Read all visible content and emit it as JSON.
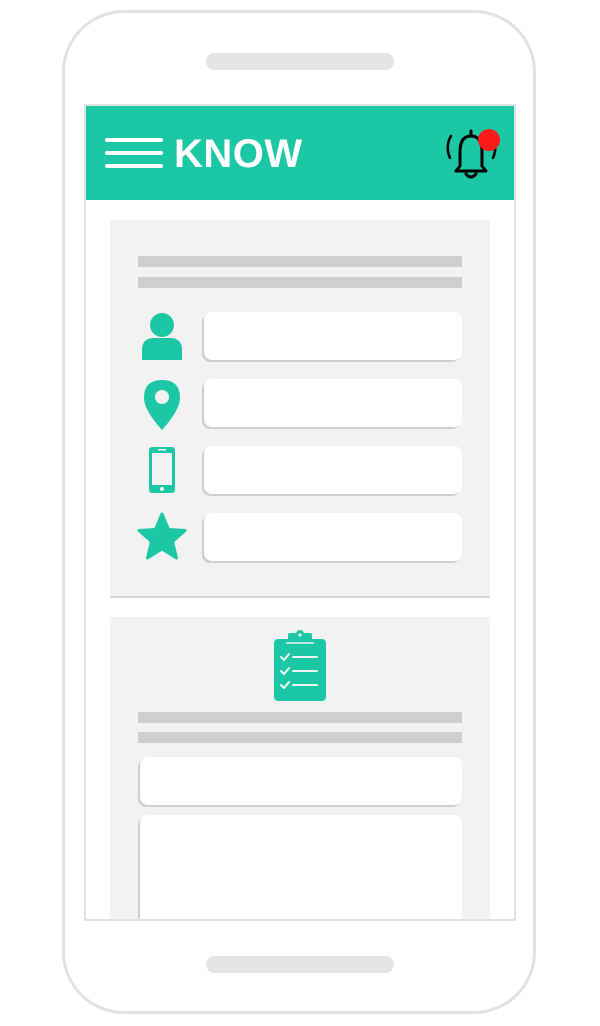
{
  "header": {
    "title": "KNOW",
    "menu_icon": "hamburger-menu-icon",
    "notification_icon": "bell-icon",
    "notification_badge_color": "#ff1a1a"
  },
  "colors": {
    "accent": "#1cc7a6",
    "card_background": "#f2f2f2",
    "placeholder_line": "#cfcfcf",
    "device_frame": "#e2e2e2"
  },
  "profile_card": {
    "fields": [
      {
        "icon": "user-icon",
        "value": "",
        "placeholder": ""
      },
      {
        "icon": "location-pin-icon",
        "value": "",
        "placeholder": ""
      },
      {
        "icon": "mobile-phone-icon",
        "value": "",
        "placeholder": ""
      },
      {
        "icon": "star-icon",
        "value": "",
        "placeholder": ""
      }
    ]
  },
  "task_card": {
    "icon": "clipboard-checklist-icon",
    "title_field": {
      "value": "",
      "placeholder": ""
    },
    "body_field": {
      "value": "",
      "placeholder": ""
    }
  }
}
